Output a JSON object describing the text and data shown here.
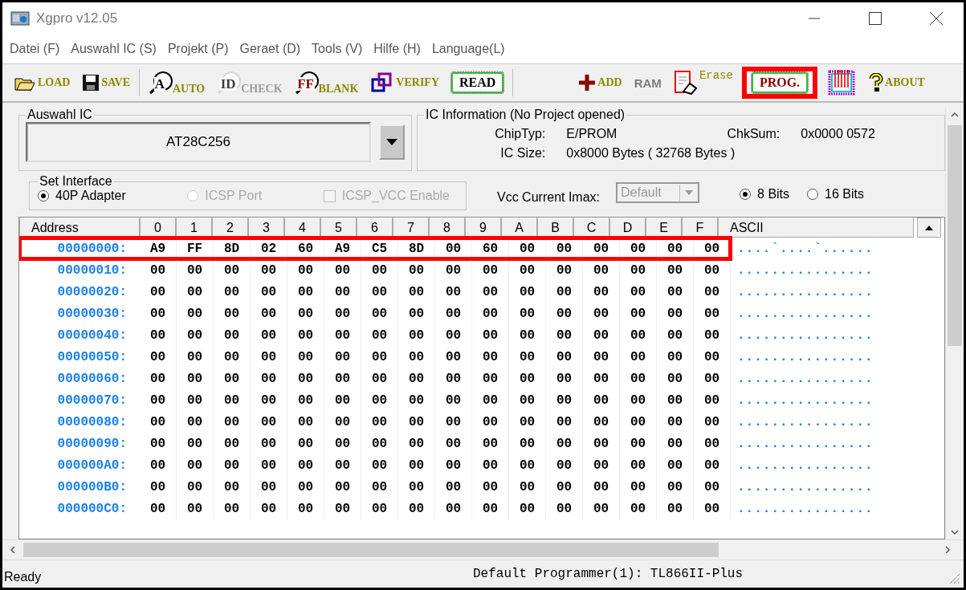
{
  "window": {
    "title": "Xgpro v12.05"
  },
  "menu": [
    "Datei (F)",
    "Auswahl IC (S)",
    "Projekt (P)",
    "Geraet (D)",
    "Tools (V)",
    "Hilfe (H)",
    "Language(L)"
  ],
  "toolbar": [
    {
      "kind": "load",
      "label": "LOAD",
      "disabled": false,
      "highlighted": false
    },
    {
      "kind": "save",
      "label": "SAVE",
      "disabled": false,
      "highlighted": false
    },
    {
      "kind": "separator"
    },
    {
      "kind": "lens",
      "glyph": "A",
      "label": "AUTO",
      "disabled": false,
      "highlighted": false
    },
    {
      "kind": "lens",
      "glyph": "ID",
      "label": "CHECK",
      "disabled": true,
      "highlighted": false
    },
    {
      "kind": "lens",
      "glyph": "FF",
      "label": "BLANK",
      "disabled": false,
      "highlighted": false
    },
    {
      "kind": "verify",
      "label": "VERIFY",
      "disabled": false,
      "highlighted": false
    },
    {
      "kind": "boxed",
      "label": "READ",
      "disabled": false,
      "highlighted": false
    },
    {
      "kind": "separator"
    },
    {
      "kind": "add",
      "label": "ADD",
      "disabled": false,
      "highlighted": false
    },
    {
      "kind": "ram",
      "label": "RAM",
      "disabled": true,
      "highlighted": false
    },
    {
      "kind": "erase",
      "label": "Erase",
      "disabled": false,
      "highlighted": false
    },
    {
      "kind": "boxed",
      "label": "PROG.",
      "disabled": false,
      "highlighted": true
    },
    {
      "kind": "chip",
      "disabled": false,
      "highlighted": false
    },
    {
      "kind": "about",
      "label": "ABOUT",
      "disabled": false,
      "highlighted": false
    }
  ],
  "ic_select": {
    "title": "Auswahl IC",
    "value": "AT28C256"
  },
  "ic_info": {
    "title": "IC Information (No Project opened)",
    "fields": [
      {
        "label": "ChipTyp:",
        "value": "E/PROM"
      },
      {
        "label": "ChkSum:",
        "value": "0x0000 0572"
      },
      {
        "label": "IC Size:",
        "value": "0x8000 Bytes ( 32768 Bytes )"
      }
    ]
  },
  "interface": {
    "title": "Set Interface",
    "options": [
      {
        "kind": "radio",
        "label": "40P Adapter",
        "selected": true,
        "disabled": false
      },
      {
        "kind": "radio",
        "label": "ICSP Port",
        "selected": false,
        "disabled": true
      },
      {
        "kind": "checkbox",
        "label": "ICSP_VCC Enable",
        "checked": false,
        "disabled": true
      }
    ]
  },
  "vcc": {
    "label": "Vcc Current Imax:",
    "value": "Default",
    "disabled": true
  },
  "bits": [
    {
      "label": "8 Bits",
      "selected": true
    },
    {
      "label": "16 Bits",
      "selected": false
    }
  ],
  "hex": {
    "columns": [
      "Address",
      "0",
      "1",
      "2",
      "3",
      "4",
      "5",
      "6",
      "7",
      "8",
      "9",
      "A",
      "B",
      "C",
      "D",
      "E",
      "F",
      "ASCII"
    ],
    "rows": [
      {
        "address": "00000000:",
        "bytes": [
          "A9",
          "FF",
          "8D",
          "02",
          "60",
          "A9",
          "C5",
          "8D",
          "00",
          "60",
          "00",
          "00",
          "00",
          "00",
          "00",
          "00"
        ],
        "ascii": "....`....`......",
        "highlighted": true
      },
      {
        "address": "00000010:",
        "bytes": [
          "00",
          "00",
          "00",
          "00",
          "00",
          "00",
          "00",
          "00",
          "00",
          "00",
          "00",
          "00",
          "00",
          "00",
          "00",
          "00"
        ],
        "ascii": "................",
        "highlighted": false
      },
      {
        "address": "00000020:",
        "bytes": [
          "00",
          "00",
          "00",
          "00",
          "00",
          "00",
          "00",
          "00",
          "00",
          "00",
          "00",
          "00",
          "00",
          "00",
          "00",
          "00"
        ],
        "ascii": "................",
        "highlighted": false
      },
      {
        "address": "00000030:",
        "bytes": [
          "00",
          "00",
          "00",
          "00",
          "00",
          "00",
          "00",
          "00",
          "00",
          "00",
          "00",
          "00",
          "00",
          "00",
          "00",
          "00"
        ],
        "ascii": "................",
        "highlighted": false
      },
      {
        "address": "00000040:",
        "bytes": [
          "00",
          "00",
          "00",
          "00",
          "00",
          "00",
          "00",
          "00",
          "00",
          "00",
          "00",
          "00",
          "00",
          "00",
          "00",
          "00"
        ],
        "ascii": "................",
        "highlighted": false
      },
      {
        "address": "00000050:",
        "bytes": [
          "00",
          "00",
          "00",
          "00",
          "00",
          "00",
          "00",
          "00",
          "00",
          "00",
          "00",
          "00",
          "00",
          "00",
          "00",
          "00"
        ],
        "ascii": "................",
        "highlighted": false
      },
      {
        "address": "00000060:",
        "bytes": [
          "00",
          "00",
          "00",
          "00",
          "00",
          "00",
          "00",
          "00",
          "00",
          "00",
          "00",
          "00",
          "00",
          "00",
          "00",
          "00"
        ],
        "ascii": "................",
        "highlighted": false
      },
      {
        "address": "00000070:",
        "bytes": [
          "00",
          "00",
          "00",
          "00",
          "00",
          "00",
          "00",
          "00",
          "00",
          "00",
          "00",
          "00",
          "00",
          "00",
          "00",
          "00"
        ],
        "ascii": "................",
        "highlighted": false
      },
      {
        "address": "00000080:",
        "bytes": [
          "00",
          "00",
          "00",
          "00",
          "00",
          "00",
          "00",
          "00",
          "00",
          "00",
          "00",
          "00",
          "00",
          "00",
          "00",
          "00"
        ],
        "ascii": "................",
        "highlighted": false
      },
      {
        "address": "00000090:",
        "bytes": [
          "00",
          "00",
          "00",
          "00",
          "00",
          "00",
          "00",
          "00",
          "00",
          "00",
          "00",
          "00",
          "00",
          "00",
          "00",
          "00"
        ],
        "ascii": "................",
        "highlighted": false
      },
      {
        "address": "000000A0:",
        "bytes": [
          "00",
          "00",
          "00",
          "00",
          "00",
          "00",
          "00",
          "00",
          "00",
          "00",
          "00",
          "00",
          "00",
          "00",
          "00",
          "00"
        ],
        "ascii": "................",
        "highlighted": false
      },
      {
        "address": "000000B0:",
        "bytes": [
          "00",
          "00",
          "00",
          "00",
          "00",
          "00",
          "00",
          "00",
          "00",
          "00",
          "00",
          "00",
          "00",
          "00",
          "00",
          "00"
        ],
        "ascii": "................",
        "highlighted": false
      },
      {
        "address": "000000C0:",
        "bytes": [
          "00",
          "00",
          "00",
          "00",
          "00",
          "00",
          "00",
          "00",
          "00",
          "00",
          "00",
          "00",
          "00",
          "00",
          "00",
          "00"
        ],
        "ascii": "................",
        "highlighted": false
      }
    ]
  },
  "status_bar": {
    "left": "Ready",
    "right": "Default Programmer(1): TL866II-Plus"
  }
}
